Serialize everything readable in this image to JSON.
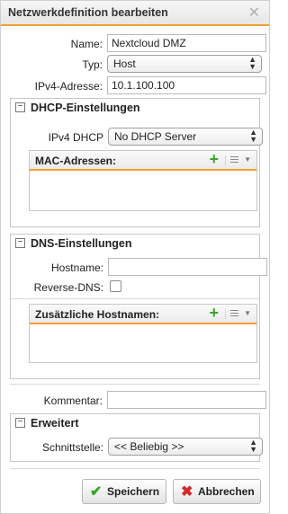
{
  "dialog": {
    "title": "Netzwerkdefinition bearbeiten",
    "close_glyph": "✕"
  },
  "form": {
    "name_label": "Name:",
    "name_value": "Nextcloud DMZ",
    "typ_label": "Typ:",
    "typ_value": "Host",
    "ipv4_label": "IPv4-Adresse:",
    "ipv4_value": "10.1.100.100"
  },
  "dhcp": {
    "title": "DHCP-Einstellungen",
    "toggle": "−",
    "ipv4_dhcp_label": "IPv4 DHCP",
    "ipv4_dhcp_value": "No DHCP Server",
    "mac_list_title": "MAC-Adressen:"
  },
  "dns": {
    "title": "DNS-Einstellungen",
    "toggle": "−",
    "hostname_label": "Hostname:",
    "hostname_value": "",
    "reverse_dns_label": "Reverse-DNS:",
    "reverse_dns_checked": false,
    "hostnames_list_title": "Zusätzliche Hostnamen:"
  },
  "comment": {
    "label": "Kommentar:",
    "value": ""
  },
  "advanced": {
    "title": "Erweitert",
    "toggle": "−",
    "interface_label": "Schnittstelle:",
    "interface_value": "<< Beliebig >>"
  },
  "buttons": {
    "save_label": "Speichern",
    "cancel_label": "Abbrechen"
  },
  "colors": {
    "accent": "#f0a030",
    "save_icon": "#3aa52a",
    "cancel_icon": "#d22b2b"
  },
  "icons": {
    "add": "plus-icon",
    "list_menu": "list-menu-icon",
    "save": "checkmark-icon",
    "cancel": "cross-icon"
  }
}
